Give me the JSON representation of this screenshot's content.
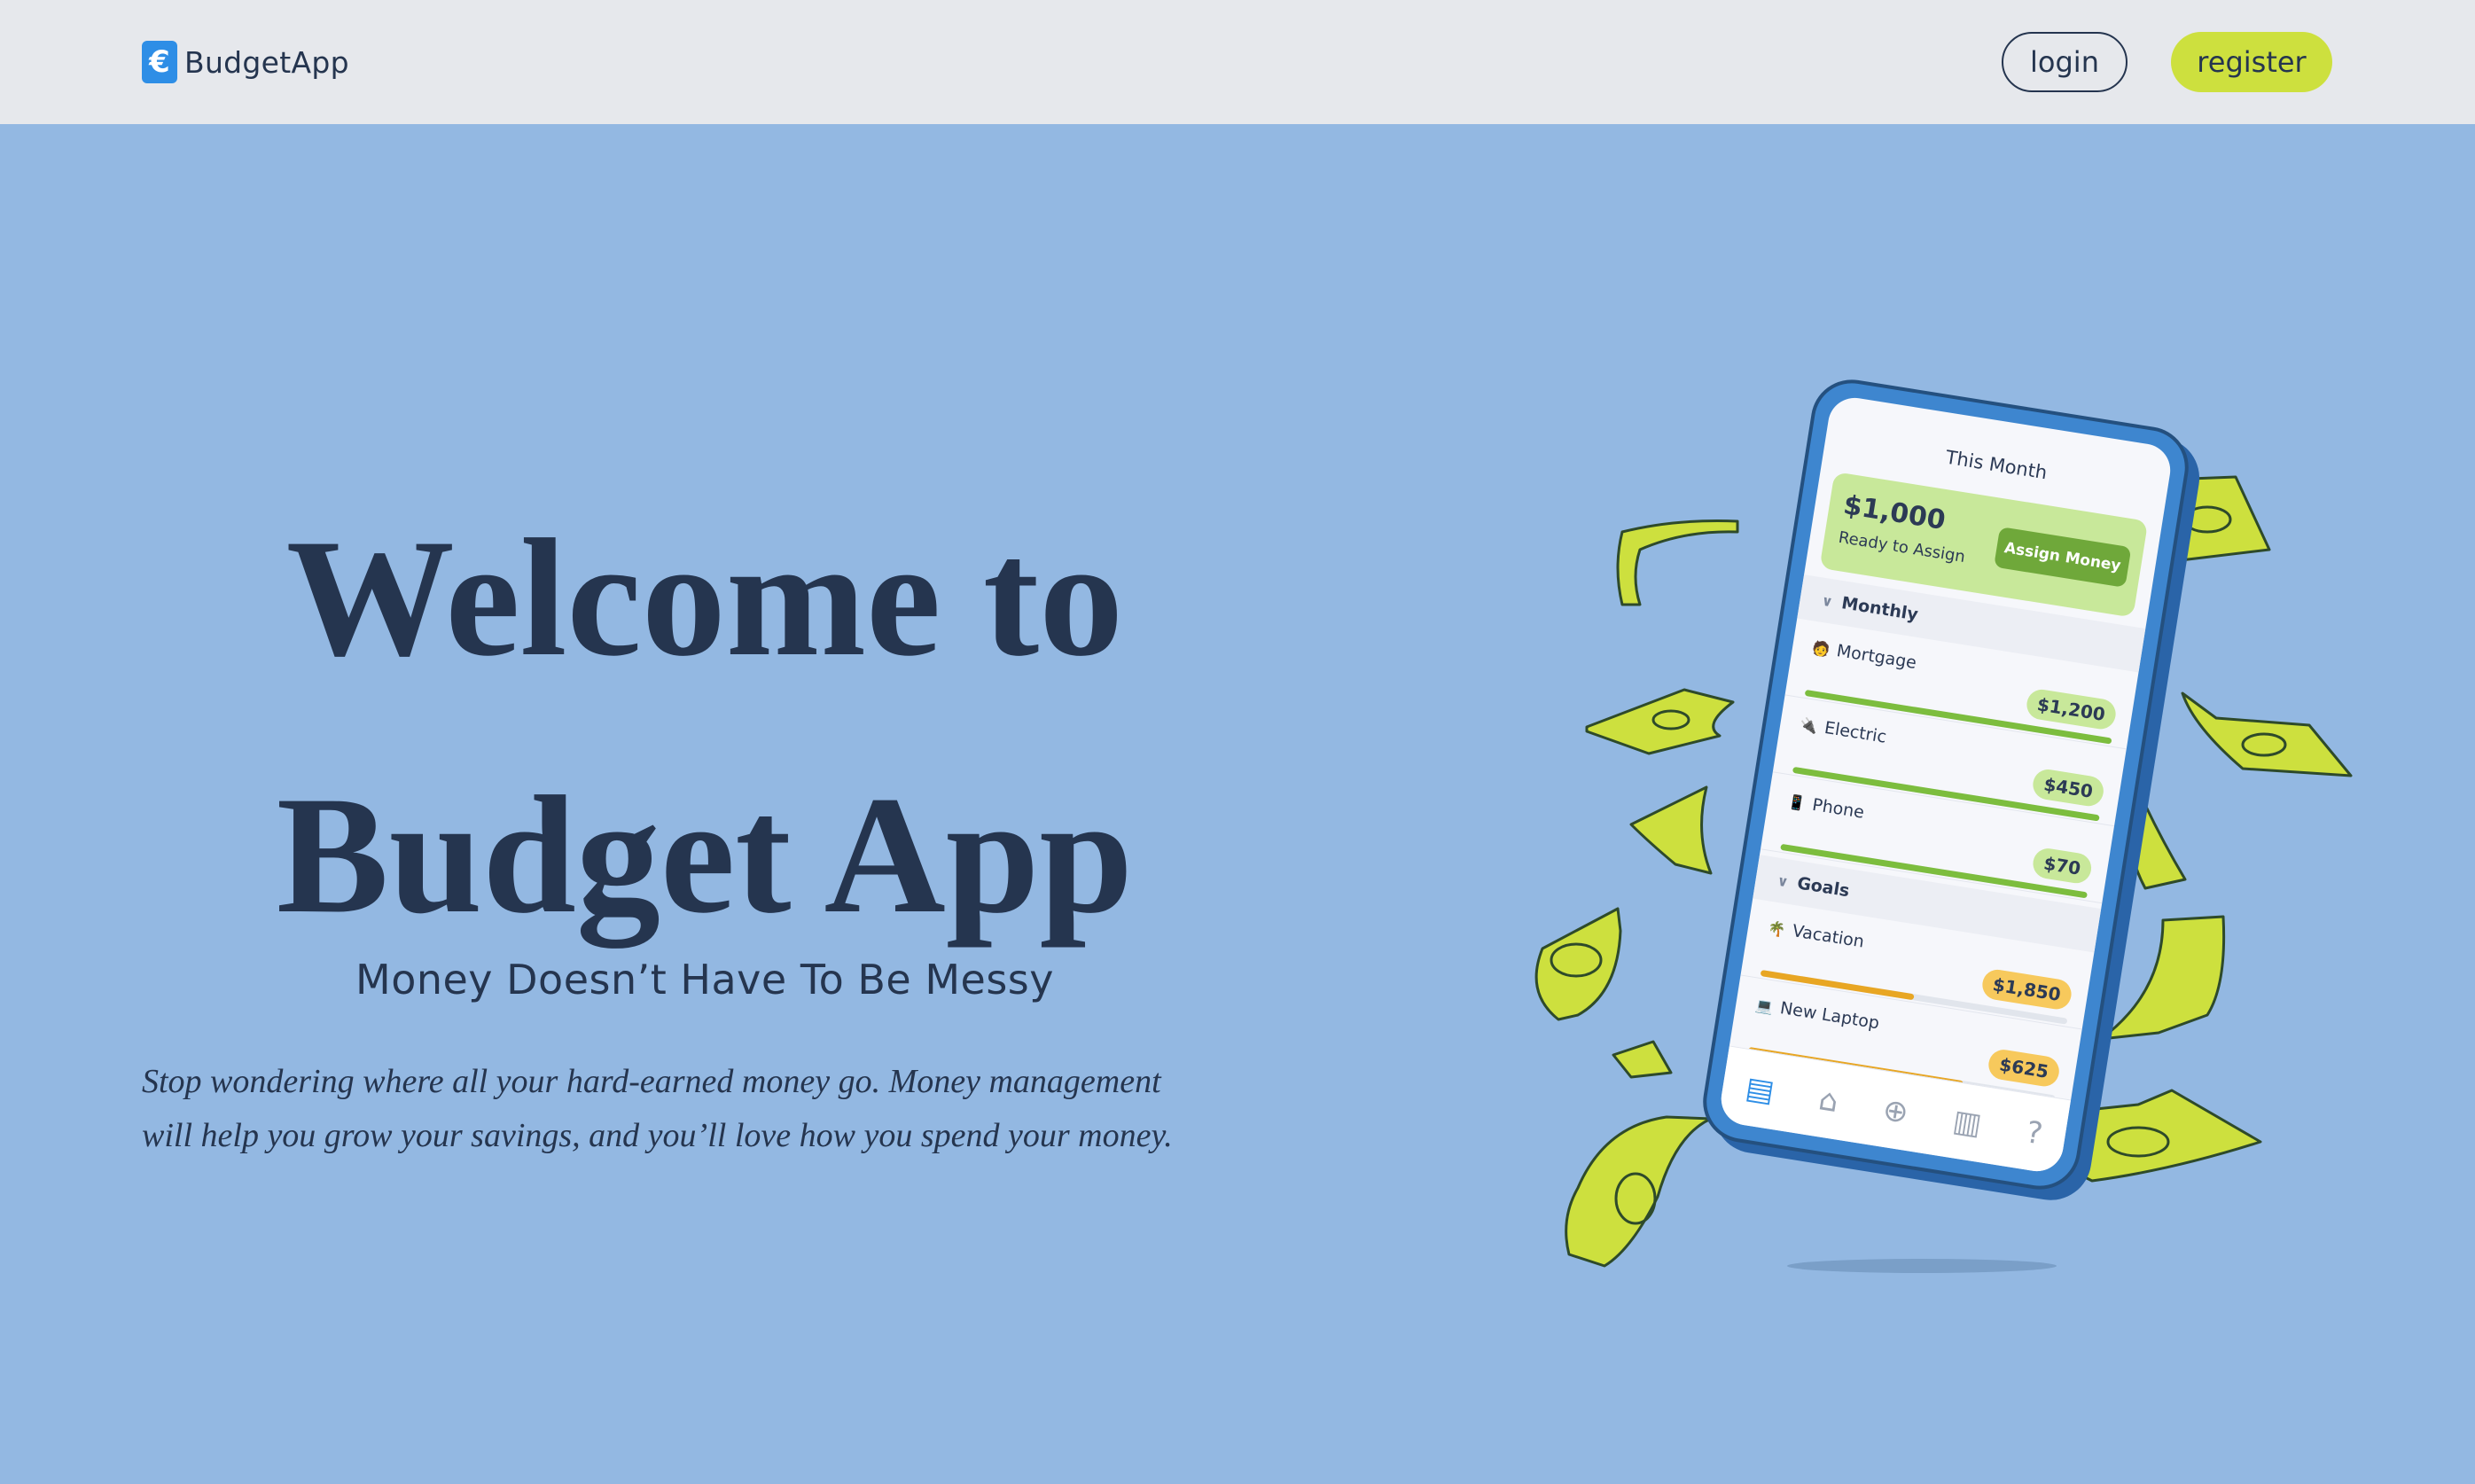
{
  "nav": {
    "brand_icon": "€",
    "brand_name": "BudgetApp",
    "login_label": "login",
    "register_label": "register"
  },
  "hero": {
    "title_line1": "Welcome to",
    "title_line2": "Budget App",
    "subtitle": "Money Doesn’t Have To Be Messy",
    "body_line1": "Stop wondering where all your hard-earned money go. Money management",
    "body_line2": "will help you grow your savings, and you’ll love how you spend your money."
  },
  "phone": {
    "title": "This Month",
    "assign": {
      "amount": "$1,000",
      "caption": "Ready to Assign",
      "button": "Assign Money"
    },
    "groups": [
      {
        "name": "Monthly",
        "items": [
          {
            "icon": "🧑",
            "label": "Mortgage",
            "amount": "$1,200",
            "progress": 1.0
          },
          {
            "icon": "🔌",
            "label": "Electric",
            "amount": "$450",
            "progress": 1.0
          },
          {
            "icon": "📱",
            "label": "Phone",
            "amount": "$70",
            "progress": 1.0
          }
        ]
      },
      {
        "name": "Goals",
        "items": [
          {
            "icon": "🌴",
            "label": "Vacation",
            "amount": "$1,850",
            "progress": 0.5
          },
          {
            "icon": "💻",
            "label": "New Laptop",
            "amount": "$625",
            "progress": 0.7
          }
        ]
      }
    ],
    "tabs": [
      "budget-icon",
      "bank-icon",
      "add-icon",
      "reports-icon",
      "help-icon"
    ]
  },
  "colors": {
    "background": "#93b8e2",
    "navbar": "#e6e8ec",
    "text": "#25354f",
    "accent": "#cde03e",
    "brand": "#2e8ee6"
  }
}
